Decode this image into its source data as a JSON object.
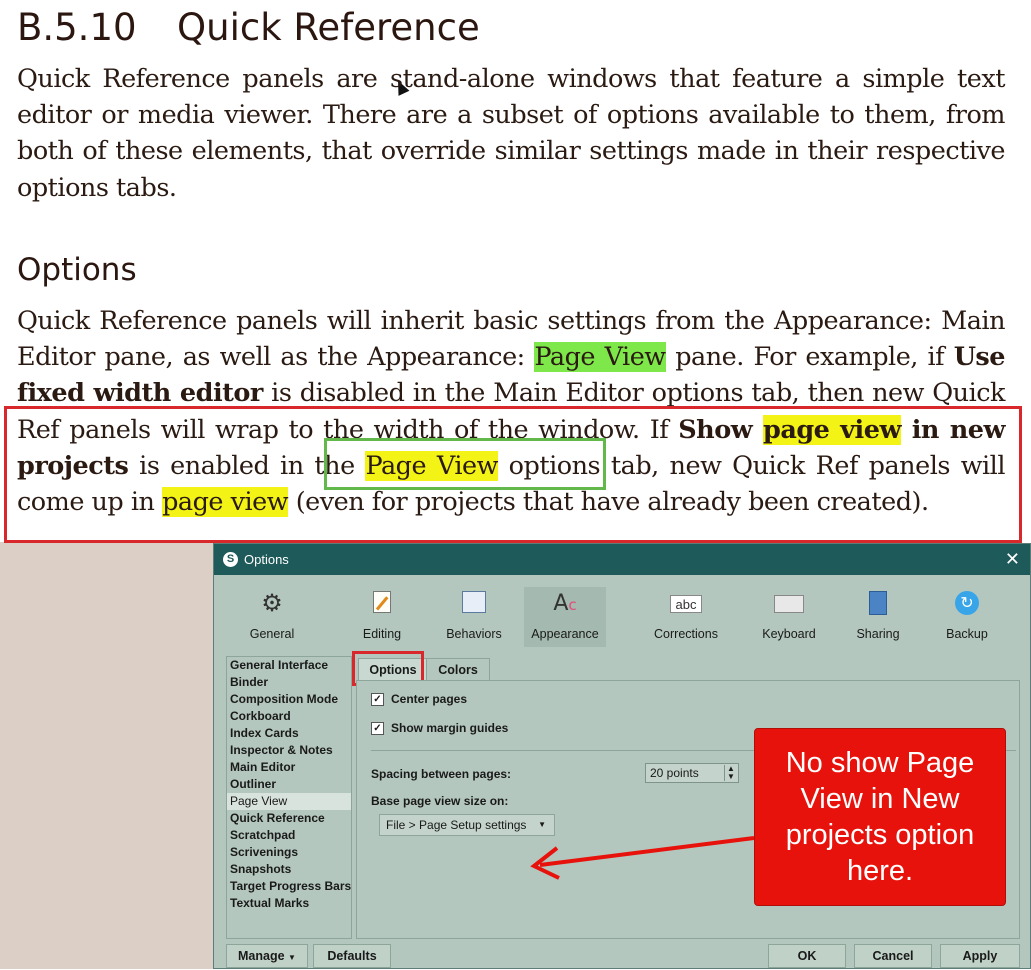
{
  "document": {
    "section_number": "B.5.10",
    "section_title": "Quick Reference",
    "intro": "Quick Reference panels are stand-alone windows that feature a simple text editor or media viewer. There are a subset of options available to them, from both of these elements, that override similar settings made in their respective options tabs.",
    "options_heading": "Options",
    "para2": {
      "a": "Quick Reference panels will inherit basic settings from the Appearance: Main Editor pane, as well as the Appearance: ",
      "page_view_1": "Page View",
      "b": " pane. For example, if ",
      "use_fixed": "Use fixed width editor",
      "c": " is disabled in the Main Editor options tab, then new Quick Ref panels will wrap to the width of the window. If ",
      "show_a": "Show ",
      "show_hl": "page view",
      "show_b": " in new projects",
      "d": " is enabled in the ",
      "page_view_2": "Page View",
      "e": " options tab",
      "f": ", new Quick Ref panels will come up in ",
      "page_view_3": "page view",
      "g": " (even for projects that have already been created)."
    }
  },
  "window": {
    "title": "Options",
    "close": "✕",
    "app_icon": "S",
    "toolbar": [
      {
        "label": "General",
        "icon": "gears-icon"
      },
      {
        "label": "Editing",
        "icon": "pencil-icon"
      },
      {
        "label": "Behaviors",
        "icon": "window-gear-icon"
      },
      {
        "label": "Appearance",
        "icon": "font-color-icon"
      },
      {
        "label": "Corrections",
        "icon": "abc-icon"
      },
      {
        "label": "Keyboard",
        "icon": "keyboard-icon"
      },
      {
        "label": "Sharing",
        "icon": "share-icon"
      },
      {
        "label": "Backup",
        "icon": "backup-icon"
      }
    ],
    "sidebar": [
      "General Interface",
      "Binder",
      "Composition Mode",
      "Corkboard",
      "Index Cards",
      "Inspector & Notes",
      "Main Editor",
      "Outliner",
      "Page View",
      "Quick Reference",
      "Scratchpad",
      "Scrivenings",
      "Snapshots",
      "Target Progress Bars",
      "Textual Marks"
    ],
    "selected_sidebar": "Page View",
    "tabs": [
      "Options",
      "Colors"
    ],
    "options": {
      "center_pages": "Center pages",
      "show_margin_guides": "Show margin guides",
      "spacing_label": "Spacing between pages:",
      "spacing_value": "20 points",
      "base_size_label": "Base page view size on:",
      "base_size_value": "File > Page Setup settings"
    },
    "buttons": {
      "manage": "Manage",
      "defaults": "Defaults",
      "ok": "OK",
      "cancel": "Cancel",
      "apply": "Apply"
    }
  },
  "callout": {
    "text": "No show Page View in New projects option here."
  },
  "colors": {
    "highlight_yellow": "#f3f315",
    "highlight_green": "#7ee84a",
    "red_annotation": "#d9282b",
    "green_annotation": "#62b84b",
    "window_titlebar": "#1f5a5a"
  }
}
